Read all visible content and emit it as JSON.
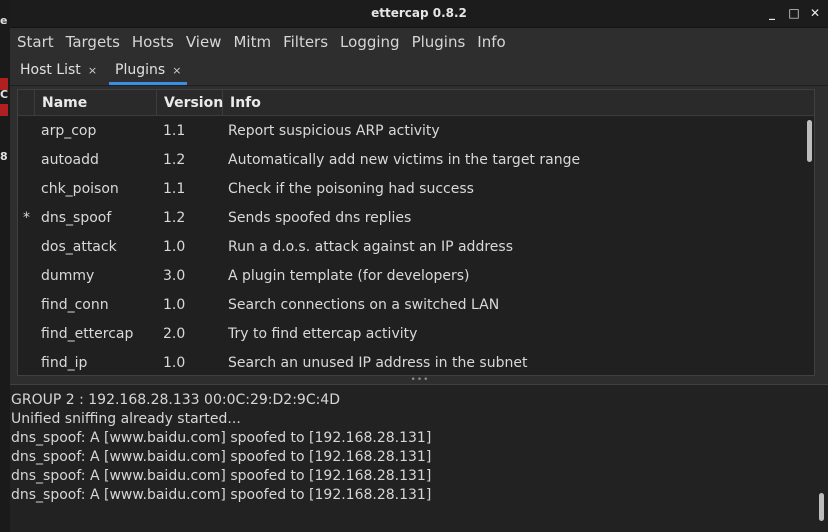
{
  "window": {
    "title": "ettercap 0.8.2",
    "controls": {
      "minimize": "_",
      "maximize": "□",
      "close": "✕"
    }
  },
  "menu": [
    "Start",
    "Targets",
    "Hosts",
    "View",
    "Mitm",
    "Filters",
    "Logging",
    "Plugins",
    "Info"
  ],
  "tabs": [
    {
      "label": "Host List",
      "close": "×",
      "active": false
    },
    {
      "label": "Plugins",
      "close": "×",
      "active": true
    }
  ],
  "plugins_table": {
    "columns": {
      "mark": "",
      "name": "Name",
      "version": "Version",
      "info": "Info"
    },
    "rows": [
      {
        "mark": "",
        "name": "arp_cop",
        "version": "1.1",
        "info": "Report suspicious ARP activity"
      },
      {
        "mark": "",
        "name": "autoadd",
        "version": "1.2",
        "info": "Automatically add new victims in the target range"
      },
      {
        "mark": "",
        "name": "chk_poison",
        "version": "1.1",
        "info": "Check if the poisoning had success"
      },
      {
        "mark": "*",
        "name": "dns_spoof",
        "version": "1.2",
        "info": "Sends spoofed dns replies"
      },
      {
        "mark": "",
        "name": "dos_attack",
        "version": "1.0",
        "info": "Run a d.o.s. attack against an IP address"
      },
      {
        "mark": "",
        "name": "dummy",
        "version": "3.0",
        "info": "A plugin template (for developers)"
      },
      {
        "mark": "",
        "name": "find_conn",
        "version": "1.0",
        "info": "Search connections on a switched LAN"
      },
      {
        "mark": "",
        "name": "find_ettercap",
        "version": "2.0",
        "info": "Try to find ettercap activity"
      },
      {
        "mark": "",
        "name": "find_ip",
        "version": "1.0",
        "info": "Search an unused IP address in the subnet"
      }
    ]
  },
  "log": {
    "lines": [
      " GROUP 2 : 192.168.28.133 00:0C:29:D2:9C:4D",
      "Unified sniffing already started...",
      "dns_spoof: A [www.baidu.com] spoofed to [192.168.28.131]",
      "dns_spoof: A [www.baidu.com] spoofed to [192.168.28.131]",
      "dns_spoof: A [www.baidu.com] spoofed to [192.168.28.131]",
      "dns_spoof: A [www.baidu.com] spoofed to [192.168.28.131]"
    ]
  },
  "left_strip_glyphs": [
    "e",
    "C",
    "8"
  ],
  "colors": {
    "accent": "#3a8ee6",
    "background": "#2e2e2e",
    "titlebar": "#1c1c1c"
  }
}
